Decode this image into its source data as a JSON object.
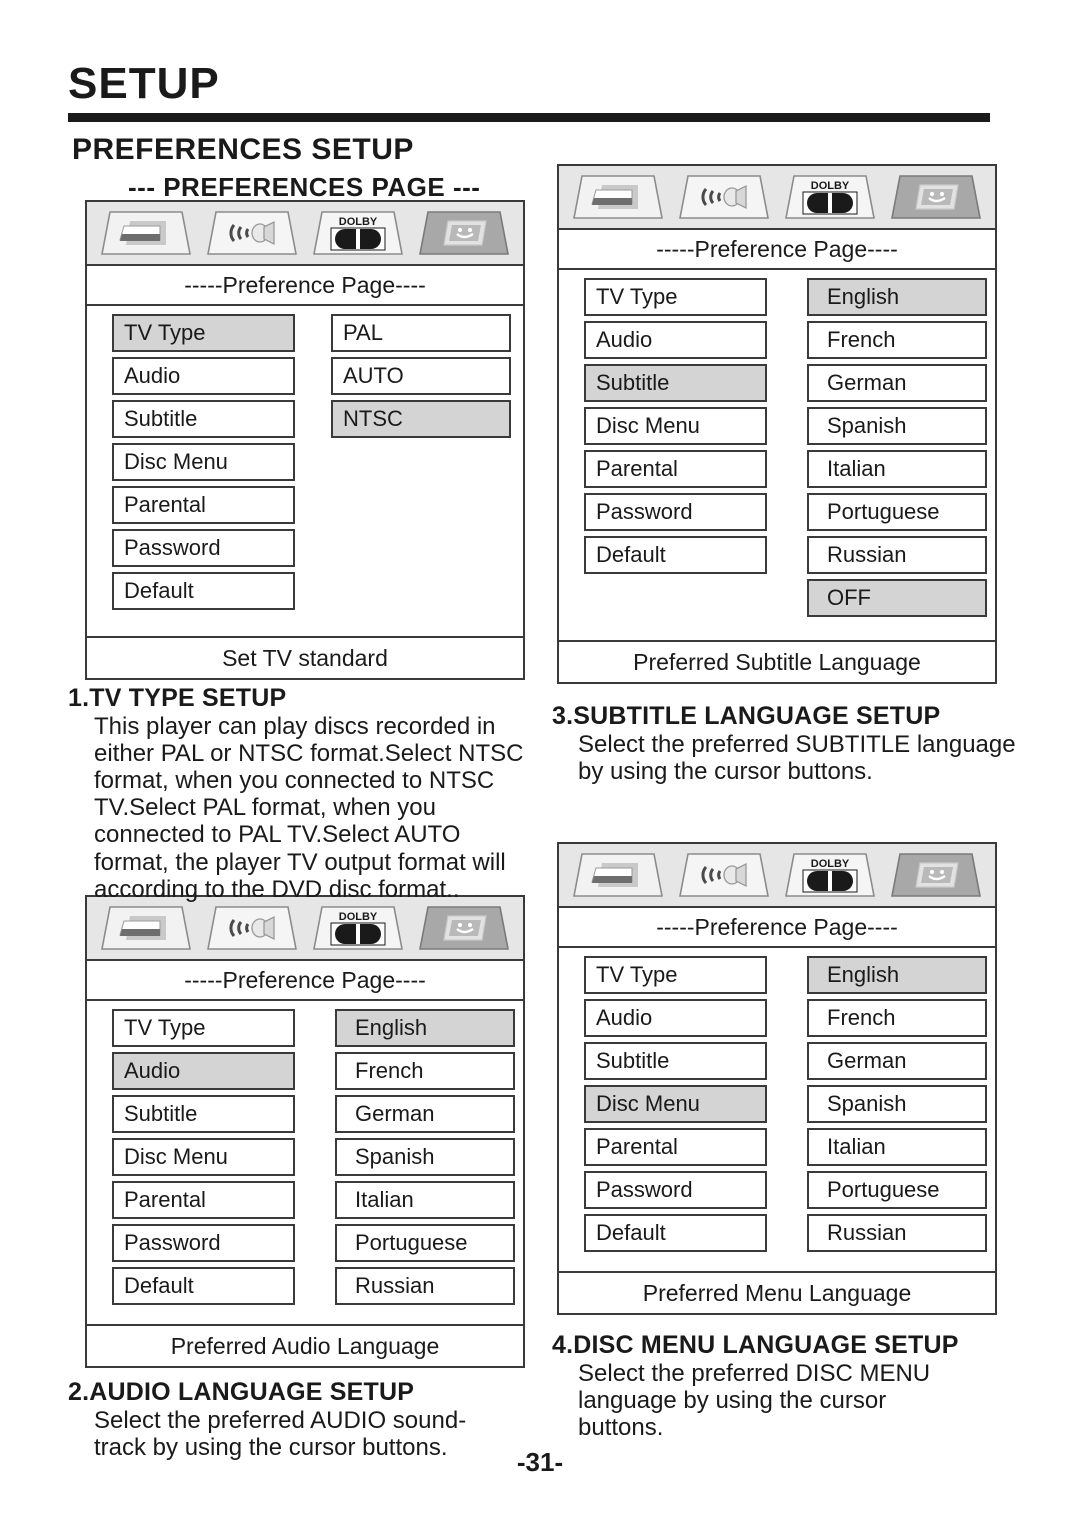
{
  "header": {
    "doc_title": "SETUP",
    "section_title": "PREFERENCES SETUP",
    "page_sub_title": "--- PREFERENCES PAGE ---"
  },
  "icons": {
    "general_setup": "tv-screen-icon",
    "audio_setup": "speaker-icon",
    "dolby_digital": "dolby-logo-icon",
    "preferences": "preferences-icon",
    "dolby_label": "DOLBY"
  },
  "panels": [
    {
      "id": "tv-type",
      "title": "-----Preference Page----",
      "menu": [
        "TV Type",
        "Audio",
        "Subtitle",
        "Disc Menu",
        "Parental",
        "Password",
        "Default"
      ],
      "menu_selected": "TV Type",
      "options": [
        "PAL",
        "AUTO",
        "NTSC"
      ],
      "option_selected": "NTSC",
      "footer": "Set TV standard"
    },
    {
      "id": "subtitle",
      "title": "-----Preference Page----",
      "menu": [
        "TV Type",
        "Audio",
        "Subtitle",
        "Disc Menu",
        "Parental",
        "Password",
        "Default"
      ],
      "menu_selected": "Subtitle",
      "options": [
        "English",
        "French",
        "German",
        "Spanish",
        "Italian",
        "Portuguese",
        "Russian",
        "OFF"
      ],
      "option_selected": "English",
      "option_selected2": "OFF",
      "footer": "Preferred Subtitle Language"
    },
    {
      "id": "audio",
      "title": "-----Preference Page----",
      "menu": [
        "TV Type",
        "Audio",
        "Subtitle",
        "Disc Menu",
        "Parental",
        "Password",
        "Default"
      ],
      "menu_selected": "Audio",
      "options": [
        "English",
        "French",
        "German",
        "Spanish",
        "Italian",
        "Portuguese",
        "Russian"
      ],
      "option_selected": "English",
      "footer": "Preferred Audio Language"
    },
    {
      "id": "disc-menu",
      "title": "-----Preference Page----",
      "menu": [
        "TV Type",
        "Audio",
        "Subtitle",
        "Disc Menu",
        "Parental",
        "Password",
        "Default"
      ],
      "menu_selected": "Disc Menu",
      "options": [
        "English",
        "French",
        "German",
        "Spanish",
        "Italian",
        "Portuguese",
        "Russian"
      ],
      "option_selected": "English",
      "footer": "Preferred Menu Language"
    }
  ],
  "sections": {
    "tv_type": {
      "heading": "1.TV TYPE SETUP",
      "body": "This player can play discs recorded in either PAL or NTSC format.Select NTSC format, when you connected to NTSC TV.Select PAL format, when you connected to PAL TV.Select AUTO format, the player TV output format will according to the DVD disc format.."
    },
    "audio_lang": {
      "heading": "2.AUDIO LANGUAGE SETUP",
      "body": "Select the preferred AUDIO sound-track by using the cursor buttons."
    },
    "subtitle_lang": {
      "heading": "3.SUBTITLE LANGUAGE SETUP",
      "body": "Select the preferred SUBTITLE language by using the cursor buttons."
    },
    "disc_menu_lang": {
      "heading": "4.DISC MENU LANGUAGE SETUP",
      "body": "Select the preferred DISC MENU language by using the cursor buttons."
    }
  },
  "footer": {
    "page_number": "-31-"
  },
  "colors": {
    "border": "#3a3a3a",
    "highlight": "#d4d4d4",
    "iconbar_bg": "#e6e6e6",
    "text": "#1a1a1a"
  }
}
